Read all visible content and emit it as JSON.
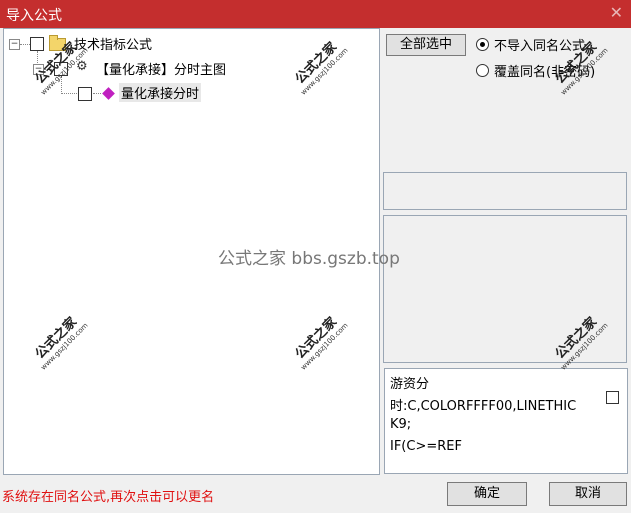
{
  "window": {
    "title": "导入公式",
    "close_icon": "close-icon"
  },
  "tree": {
    "root": {
      "label": "技术指标公式",
      "expander": "⊟"
    },
    "child": {
      "label": "【量化承接】分时主图",
      "expander": "⊟"
    },
    "leaf": {
      "label": "量化承接分时"
    }
  },
  "right": {
    "select_all_label": "全部选中",
    "radio_no_import": "不导入同名公式",
    "radio_overwrite": "覆盖同名(非密码)",
    "selected_radio": "no_import"
  },
  "note": {
    "lines": [
      "游资分",
      "时:C,COLORFFFF00,LINETHIC",
      "K9;",
      "IF(C>=REF"
    ]
  },
  "footer": {
    "status": "系统存在同名公式,再次点击可以更名",
    "ok_label": "确定",
    "cancel_label": "取消"
  },
  "watermark": {
    "text": "公式之家 bbs.gszb.top"
  },
  "stamps": {
    "big": "公式之家",
    "small": "www.gszj100.com"
  },
  "colors": {
    "titlebar": "#c42e2e",
    "status_text": "#e01010"
  }
}
